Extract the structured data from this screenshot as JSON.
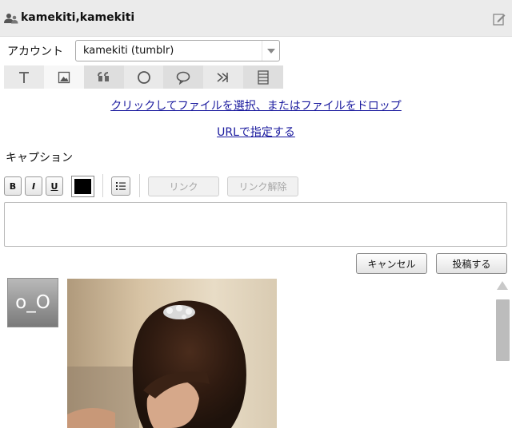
{
  "header": {
    "title": "kamekiti,kamekiti",
    "icon": "users-icon",
    "edit_icon": "edit-icon"
  },
  "account": {
    "label": "アカウント",
    "selected": "kamekiti (tumblr)"
  },
  "post_types": [
    {
      "name": "text",
      "icon": "text-icon"
    },
    {
      "name": "photo",
      "icon": "photo-icon",
      "selected": true
    },
    {
      "name": "quote",
      "icon": "quote-icon"
    },
    {
      "name": "link",
      "icon": "link-icon"
    },
    {
      "name": "chat",
      "icon": "chat-icon"
    },
    {
      "name": "audio",
      "icon": "audio-icon"
    },
    {
      "name": "video",
      "icon": "video-icon"
    }
  ],
  "upload": {
    "file_link": "クリックしてファイルを選択、またはファイルをドロップ",
    "url_link": "URLで指定する"
  },
  "caption": {
    "label": "キャプション",
    "bold": "B",
    "italic": "I",
    "underline": "U",
    "text_color": "#000000",
    "link_label": "リンク",
    "unlink_label": "リンク解除",
    "value": ""
  },
  "actions": {
    "cancel": "キャンセル",
    "post": "投稿する"
  },
  "feed": {
    "avatar_text": "o_O"
  }
}
